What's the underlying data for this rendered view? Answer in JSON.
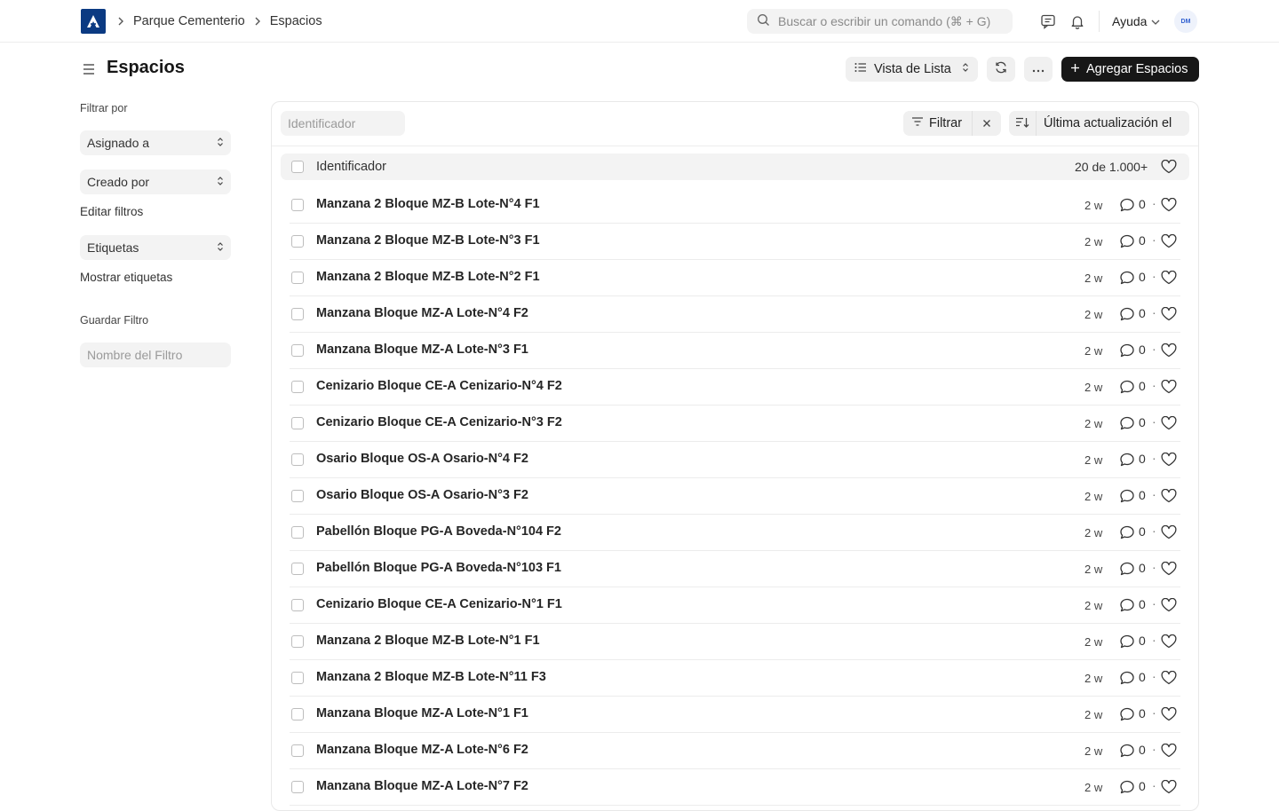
{
  "navbar": {
    "breadcrumbs": [
      "Parque Cementerio",
      "Espacios"
    ],
    "search_placeholder": "Buscar o escribir un comando (⌘ + G)",
    "help_label": "Ayuda",
    "avatar_initials": "DM"
  },
  "page": {
    "title": "Espacios",
    "view_label": "Vista de Lista",
    "add_label": "Agregar Espacios"
  },
  "sidebar": {
    "filter_by_label": "Filtrar por",
    "assigned_to": "Asignado a",
    "created_by": "Creado por",
    "edit_filters": "Editar filtros",
    "tags": "Etiquetas",
    "show_tags": "Mostrar etiquetas",
    "save_filter_label": "Guardar Filtro",
    "filter_name_placeholder": "Nombre del Filtro"
  },
  "toolbar": {
    "id_placeholder": "Identificador",
    "filter_label": "Filtrar",
    "sort_label": "Última actualización el"
  },
  "list": {
    "header_label": "Identificador",
    "count_text": "20 de 1.000+",
    "rows": [
      {
        "title": "Manzana 2 Bloque MZ-B Lote-N°4 F1",
        "time": "2 w",
        "comments": "0"
      },
      {
        "title": "Manzana 2 Bloque MZ-B Lote-N°3 F1",
        "time": "2 w",
        "comments": "0"
      },
      {
        "title": "Manzana 2 Bloque MZ-B Lote-N°2 F1",
        "time": "2 w",
        "comments": "0"
      },
      {
        "title": "Manzana Bloque MZ-A Lote-N°4 F2",
        "time": "2 w",
        "comments": "0"
      },
      {
        "title": "Manzana Bloque MZ-A Lote-N°3 F1",
        "time": "2 w",
        "comments": "0"
      },
      {
        "title": "Cenizario Bloque CE-A Cenizario-N°4 F2",
        "time": "2 w",
        "comments": "0"
      },
      {
        "title": "Cenizario Bloque CE-A Cenizario-N°3 F2",
        "time": "2 w",
        "comments": "0"
      },
      {
        "title": "Osario Bloque OS-A Osario-N°4 F2",
        "time": "2 w",
        "comments": "0"
      },
      {
        "title": "Osario Bloque OS-A Osario-N°3 F2",
        "time": "2 w",
        "comments": "0"
      },
      {
        "title": "Pabellón Bloque PG-A Boveda-N°104 F2",
        "time": "2 w",
        "comments": "0"
      },
      {
        "title": "Pabellón Bloque PG-A Boveda-N°103 F1",
        "time": "2 w",
        "comments": "0"
      },
      {
        "title": "Cenizario Bloque CE-A Cenizario-N°1 F1",
        "time": "2 w",
        "comments": "0"
      },
      {
        "title": "Manzana 2 Bloque MZ-B Lote-N°1 F1",
        "time": "2 w",
        "comments": "0"
      },
      {
        "title": "Manzana 2 Bloque MZ-B Lote-N°11 F3",
        "time": "2 w",
        "comments": "0"
      },
      {
        "title": "Manzana Bloque MZ-A Lote-N°1 F1",
        "time": "2 w",
        "comments": "0"
      },
      {
        "title": "Manzana Bloque MZ-A Lote-N°6 F2",
        "time": "2 w",
        "comments": "0"
      },
      {
        "title": "Manzana Bloque MZ-A Lote-N°7 F2",
        "time": "2 w",
        "comments": "0"
      }
    ]
  },
  "icons": {
    "logo": "app-logo-icon",
    "search": "search-icon",
    "chat": "chat-icon",
    "bell": "bell-icon",
    "menu": "hamburger-icon",
    "refresh": "refresh-icon",
    "more": "ellipsis-icon",
    "filter": "filter-icon",
    "sort": "sort-icon",
    "comment": "comment-icon",
    "like": "heart-icon"
  },
  "colors": {
    "brand": "#0b3a82",
    "primary_button": "#171717"
  }
}
